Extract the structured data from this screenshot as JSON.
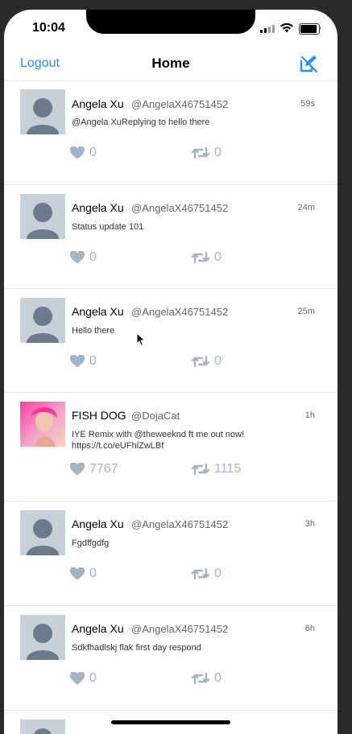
{
  "status_bar": {
    "time": "10:04"
  },
  "nav": {
    "logout_label": "Logout",
    "title": "Home",
    "compose_icon": "compose-off-icon"
  },
  "colors": {
    "accent": "#1e90ff",
    "action_gray": "#a5b4c5"
  },
  "tweets": [
    {
      "name": "Angela Xu",
      "handle": "@AngelaX46751452",
      "time": "59s",
      "body": "@Angela XuReplying to hello there",
      "likes": "0",
      "retweets": "0",
      "avatar": "default-avatar"
    },
    {
      "name": "Angela Xu",
      "handle": "@AngelaX46751452",
      "time": "24m",
      "body": "Status update 101",
      "likes": "0",
      "retweets": "0",
      "avatar": "default-avatar"
    },
    {
      "name": "Angela Xu",
      "handle": "@AngelaX46751452",
      "time": "25m",
      "body": "Hello there",
      "likes": "0",
      "retweets": "0",
      "avatar": "default-avatar"
    },
    {
      "name": "FISH DOG",
      "handle": "@DojaCat",
      "time": "1h",
      "body": "IYE Remix with @theweeknd ft me out now! https://t.co/eUFhlZwLBf",
      "likes": "7767",
      "retweets": "1115",
      "avatar": "profile-photo"
    },
    {
      "name": "Angela Xu",
      "handle": "@AngelaX46751452",
      "time": "3h",
      "body": "Fgdffgdfg",
      "likes": "0",
      "retweets": "0",
      "avatar": "default-avatar"
    },
    {
      "name": "Angela Xu",
      "handle": "@AngelaX46751452",
      "time": "6h",
      "body": "Sdkfhadlskj flak first day respond",
      "likes": "0",
      "retweets": "0",
      "avatar": "default-avatar"
    }
  ]
}
